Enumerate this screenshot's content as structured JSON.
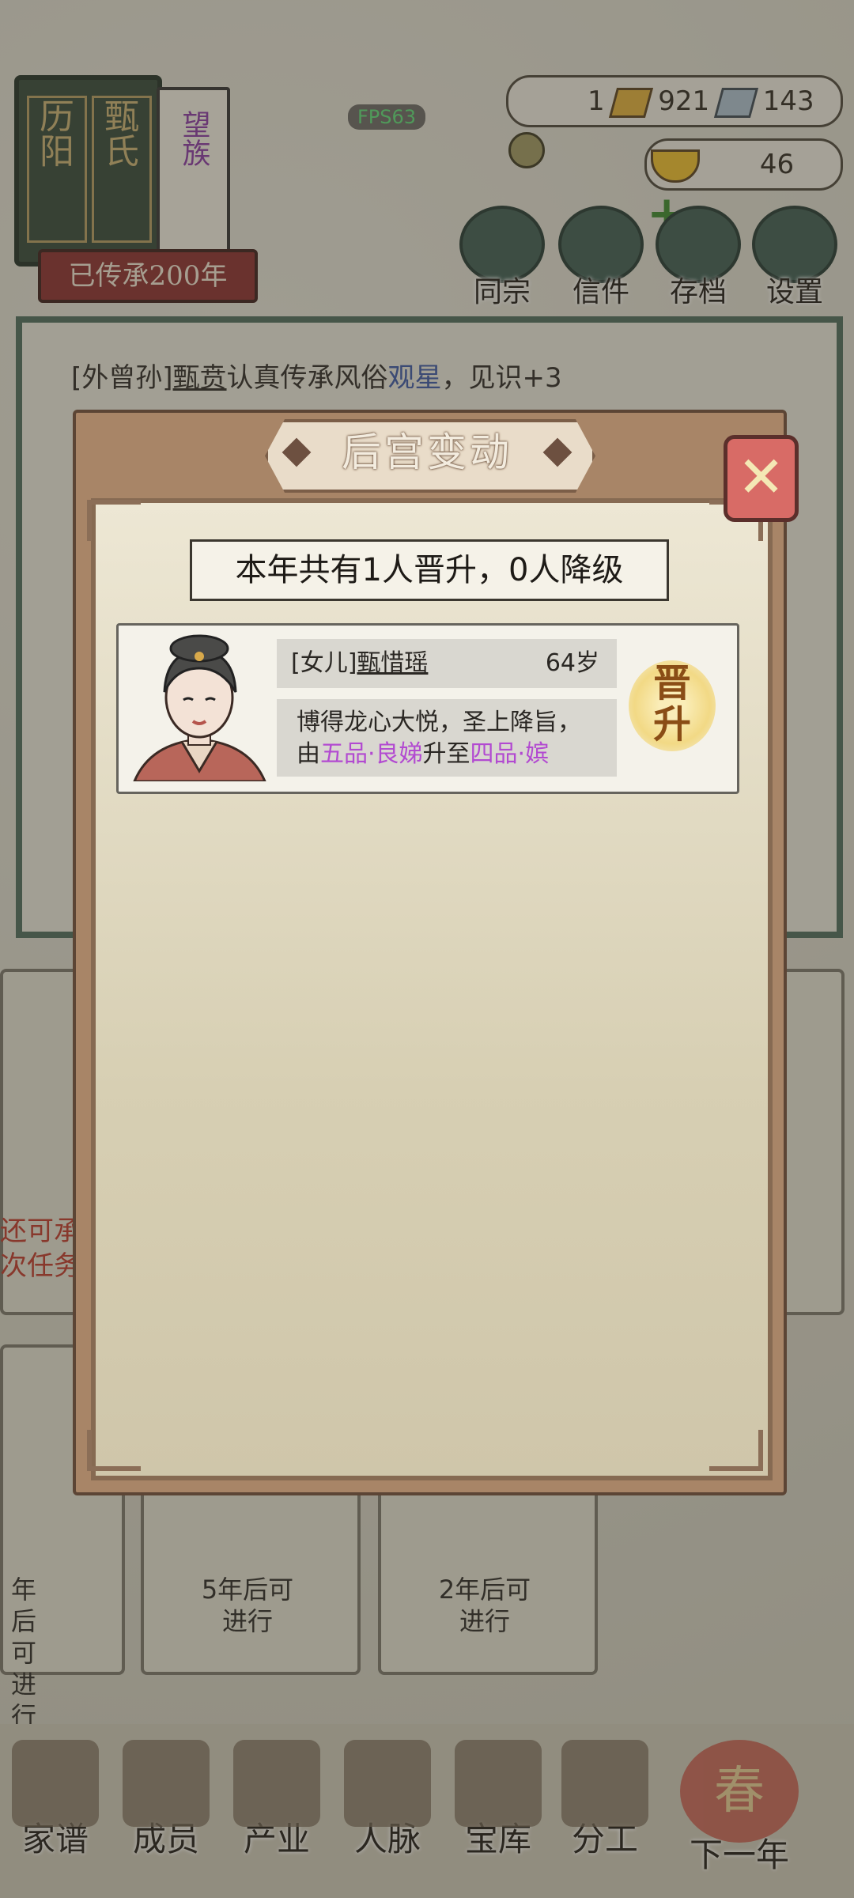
{
  "clan": {
    "family_name": "甄氏",
    "place": "历阳",
    "rank_tag": "望族",
    "heritage": "已传承200年"
  },
  "fps": "FPS63",
  "resources": {
    "gold_bars": "1",
    "silver_bars": "921",
    "coins": "143",
    "ingots": "46"
  },
  "top_menu": [
    {
      "label": "同宗"
    },
    {
      "label": "信件"
    },
    {
      "label": "存档"
    },
    {
      "label": "设置"
    }
  ],
  "log": {
    "prefix": "[外曾孙]",
    "name": "甄贲",
    "mid": "认真传承风俗",
    "custom": "观星",
    "suffix": "，见识+3"
  },
  "background_cards": {
    "left_partial_1": "还可承",
    "left_partial_2": "次任务",
    "left_time_1": "年后可",
    "left_time_2": "进行",
    "card2_1": "5年后可",
    "card2_2": "进行",
    "card3_1": "2年后可",
    "card3_2": "进行"
  },
  "bottom_nav": [
    {
      "label": "家谱"
    },
    {
      "label": "成员"
    },
    {
      "label": "产业"
    },
    {
      "label": "人脉"
    },
    {
      "label": "宝库"
    },
    {
      "label": "分工"
    },
    {
      "label": "下一年"
    }
  ],
  "spring_badge": "春",
  "modal": {
    "title": "后宫变动",
    "summary": "本年共有1人晋升，0人降级",
    "entry": {
      "relation": "[女儿]",
      "name": "甄惜瑶",
      "age": "64岁",
      "line1": "博得龙心大悦，圣上降旨，",
      "line2_prefix": "由",
      "from_rank": "五品·良娣",
      "line2_mid": "升至",
      "to_rank": "四品·嫔",
      "badge_top": "晋",
      "badge_bottom": "升"
    }
  },
  "colors": {
    "accent_purple": "#b24ad1",
    "close_red": "#d86b66",
    "panel_brown": "#a88567"
  }
}
